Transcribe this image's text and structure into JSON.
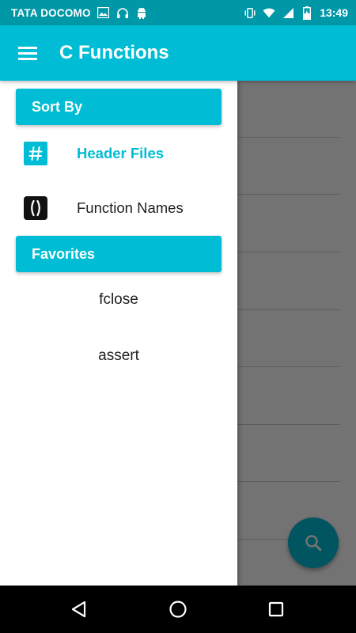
{
  "status_bar": {
    "carrier": "TATA DOCOMO",
    "time": "13:49",
    "icons": [
      "image-icon",
      "headset-icon",
      "android-icon",
      "vibrate-icon",
      "wifi-icon",
      "signal-icon",
      "battery-charging-icon"
    ]
  },
  "app_bar": {
    "title": "C Functions",
    "menu_icon": "hamburger-menu-icon"
  },
  "drawer": {
    "sort_header": "Sort By",
    "sort_items": [
      {
        "label": "Header Files",
        "icon": "hash-icon",
        "active": true
      },
      {
        "label": "Function Names",
        "icon": "parentheses-icon",
        "active": false
      }
    ],
    "favorites_header": "Favorites",
    "favorites": [
      "fclose",
      "assert"
    ]
  },
  "fab": {
    "icon": "search-icon"
  },
  "navigation_bar": {
    "buttons": [
      "back-icon",
      "home-icon",
      "recents-icon"
    ]
  },
  "colors": {
    "accent": "#00bcd4",
    "status_bar": "#0097a7",
    "text": "#212121"
  }
}
